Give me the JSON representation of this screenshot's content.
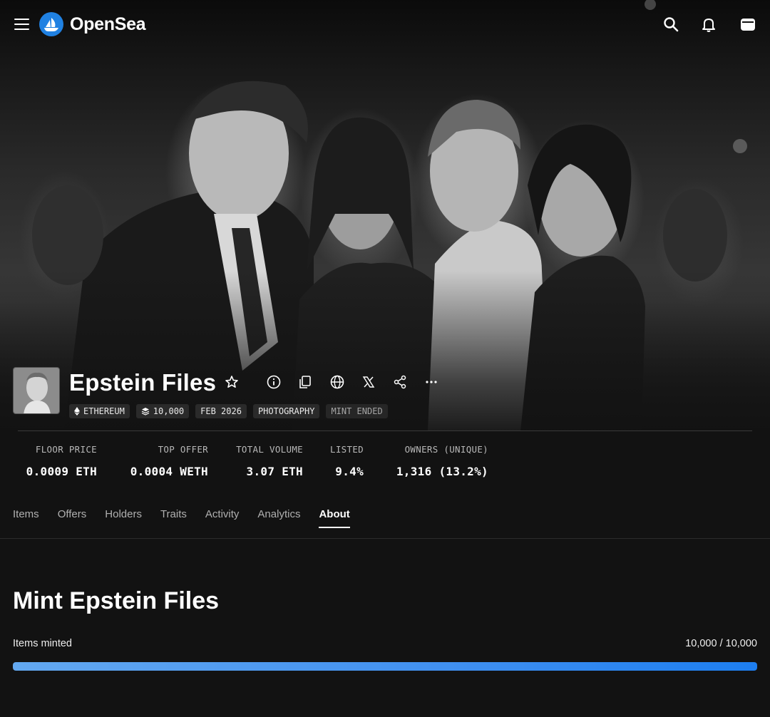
{
  "app": {
    "logo_text": "OpenSea",
    "brand_color": "#2081e2",
    "nav_icons": [
      "menu-icon",
      "search-icon",
      "bell-icon",
      "wallet-icon"
    ]
  },
  "collection": {
    "name": "Epstein Files",
    "header_icons": [
      "star-icon",
      "info-icon",
      "copy-icon",
      "globe-icon",
      "x-logo-icon",
      "share-icon",
      "more-icon"
    ],
    "tags": [
      {
        "label": "ETHEREUM",
        "icon": "ethereum-icon"
      },
      {
        "label": "10,000",
        "icon": "layers-icon"
      },
      {
        "label": "FEB 2026"
      },
      {
        "label": "PHOTOGRAPHY"
      },
      {
        "label": "MINT ENDED",
        "dim": true
      }
    ]
  },
  "stats": [
    {
      "label": "FLOOR PRICE",
      "value": "0.0009 ETH"
    },
    {
      "label": "TOP OFFER",
      "value": "0.0004 WETH"
    },
    {
      "label": "TOTAL VOLUME",
      "value": "3.07 ETH"
    },
    {
      "label": "LISTED",
      "value": "9.4%"
    },
    {
      "label": "OWNERS (UNIQUE)",
      "value": "1,316 (13.2%)"
    }
  ],
  "tabs": [
    {
      "label": "Items"
    },
    {
      "label": "Offers"
    },
    {
      "label": "Holders"
    },
    {
      "label": "Traits"
    },
    {
      "label": "Activity"
    },
    {
      "label": "Analytics"
    },
    {
      "label": "About",
      "active": true
    }
  ],
  "mint": {
    "title": "Mint Epstein Files",
    "label": "Items minted",
    "count": "10,000 / 10,000",
    "progress": 1.0
  }
}
